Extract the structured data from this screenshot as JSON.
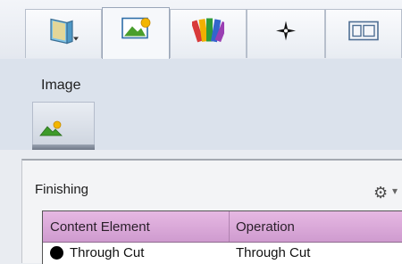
{
  "toolbar": {
    "tabs": [
      {
        "icon": "book-dropdown-icon",
        "active": false
      },
      {
        "icon": "image-icon",
        "active": true
      },
      {
        "icon": "color-swatch-icon",
        "active": false
      },
      {
        "icon": "crosshair-icon",
        "active": false
      },
      {
        "icon": "layout-icon",
        "active": false
      }
    ]
  },
  "image_panel": {
    "title": "Image",
    "subtab_icon": "image-icon"
  },
  "finishing": {
    "title": "Finishing",
    "table": {
      "columns": [
        "Content Element",
        "Operation"
      ],
      "rows": [
        {
          "content_element": "Through Cut",
          "operation": "Through Cut"
        }
      ]
    }
  },
  "colors": {
    "table_header": "#dca9db",
    "accent_green": "#3e9a2a",
    "accent_yellow": "#f2b600"
  }
}
